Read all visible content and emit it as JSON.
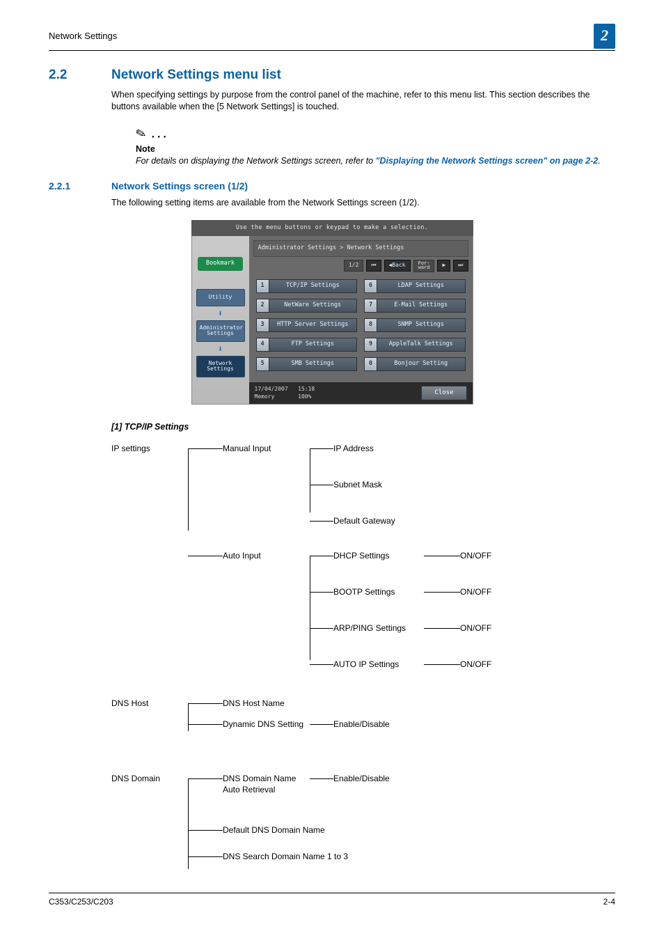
{
  "header": {
    "title": "Network Settings",
    "chapter": "2"
  },
  "section": {
    "num": "2.2",
    "title": "Network Settings menu list",
    "intro": "When specifying settings by purpose from the control panel of the machine, refer to this menu list. This section describes the buttons available when the [5 Network Settings] is touched."
  },
  "note": {
    "label": "Note",
    "text_a": "For details on displaying the Network Settings screen, refer to ",
    "link": "\"Displaying the Network Settings screen\" on page 2-2",
    "text_b": "."
  },
  "subsection": {
    "num": "2.2.1",
    "title": "Network Settings screen (1/2)",
    "intro": "The following setting items are available from the Network Settings screen (1/2)."
  },
  "panel": {
    "instruction": "Use the menu buttons or keypad to make a selection.",
    "bookmark": "Bookmark",
    "crumb1": "Utility",
    "crumb2": "Administrator Settings",
    "crumb3": "Network Settings",
    "breadcrumb": "Administrator Settings > Network Settings",
    "page": "1/2",
    "back": "◀Back",
    "fwd_a": "For-",
    "fwd_b": "ward",
    "btns": [
      {
        "n": "1",
        "t": "TCP/IP Settings"
      },
      {
        "n": "6",
        "t": "LDAP Settings"
      },
      {
        "n": "2",
        "t": "NetWare Settings"
      },
      {
        "n": "7",
        "t": "E-Mail Settings"
      },
      {
        "n": "3",
        "t": "HTTP Server Settings"
      },
      {
        "n": "8",
        "t": "SNMP Settings"
      },
      {
        "n": "4",
        "t": "FTP Settings"
      },
      {
        "n": "9",
        "t": "AppleTalk Settings"
      },
      {
        "n": "5",
        "t": "SMB Settings"
      },
      {
        "n": "0",
        "t": "Bonjour Setting"
      }
    ],
    "date": "17/04/2007",
    "time": "15:18",
    "mem_lbl": "Memory",
    "mem_val": "100%",
    "close": "Close"
  },
  "tcp_heading": "[1] TCP/IP Settings",
  "tree": {
    "ip_settings": "IP settings",
    "manual_input": "Manual Input",
    "ip_address": "IP Address",
    "subnet_mask": "Subnet Mask",
    "default_gateway": "Default Gateway",
    "auto_input": "Auto Input",
    "dhcp": "DHCP Settings",
    "bootp": "BOOTP Settings",
    "arpping": "ARP/PING Settings",
    "autoip": "AUTO IP Settings",
    "onoff": "ON/OFF",
    "dns_host": "DNS Host",
    "dns_host_name": "DNS Host Name",
    "dyn_dns": "Dynamic DNS Setting",
    "enable_disable": "Enable/Disable",
    "dns_domain": "DNS Domain",
    "dns_domain_auto": "DNS Domain Name\nAuto Retrieval",
    "default_dns_domain": "Default DNS Domain Name",
    "dns_search": "DNS Search Domain Name 1 to 3"
  },
  "footer": {
    "left": "C353/C253/C203",
    "right": "2-4"
  }
}
